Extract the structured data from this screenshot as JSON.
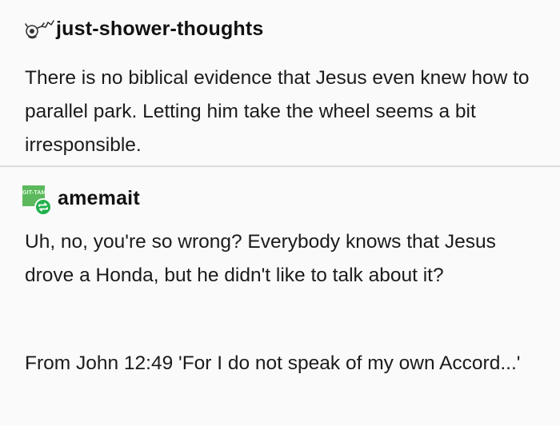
{
  "posts": [
    {
      "username": "just-shower-thoughts",
      "avatar_icon": "doodle-mask-icon",
      "paragraphs": [
        "There is no biblical evidence that Jesus even knew how to parallel park. Letting him take the wheel seems a bit irresponsible."
      ]
    },
    {
      "username": "amemait",
      "avatar_icon": "green-avatar-icon",
      "avatar_text": "GIT-TAM",
      "badge_icon": "reblog-icon",
      "paragraphs": [
        "Uh, no, you're so wrong? Everybody knows that Jesus drove a Honda, but he didn't like to talk about it?",
        "From John 12:49 'For I do not speak of my own Accord...'"
      ]
    }
  ],
  "colors": {
    "background": "#fafafa",
    "divider": "#dcdcdc",
    "avatar_green": "#5cb85c",
    "badge_green": "#22b14c"
  }
}
